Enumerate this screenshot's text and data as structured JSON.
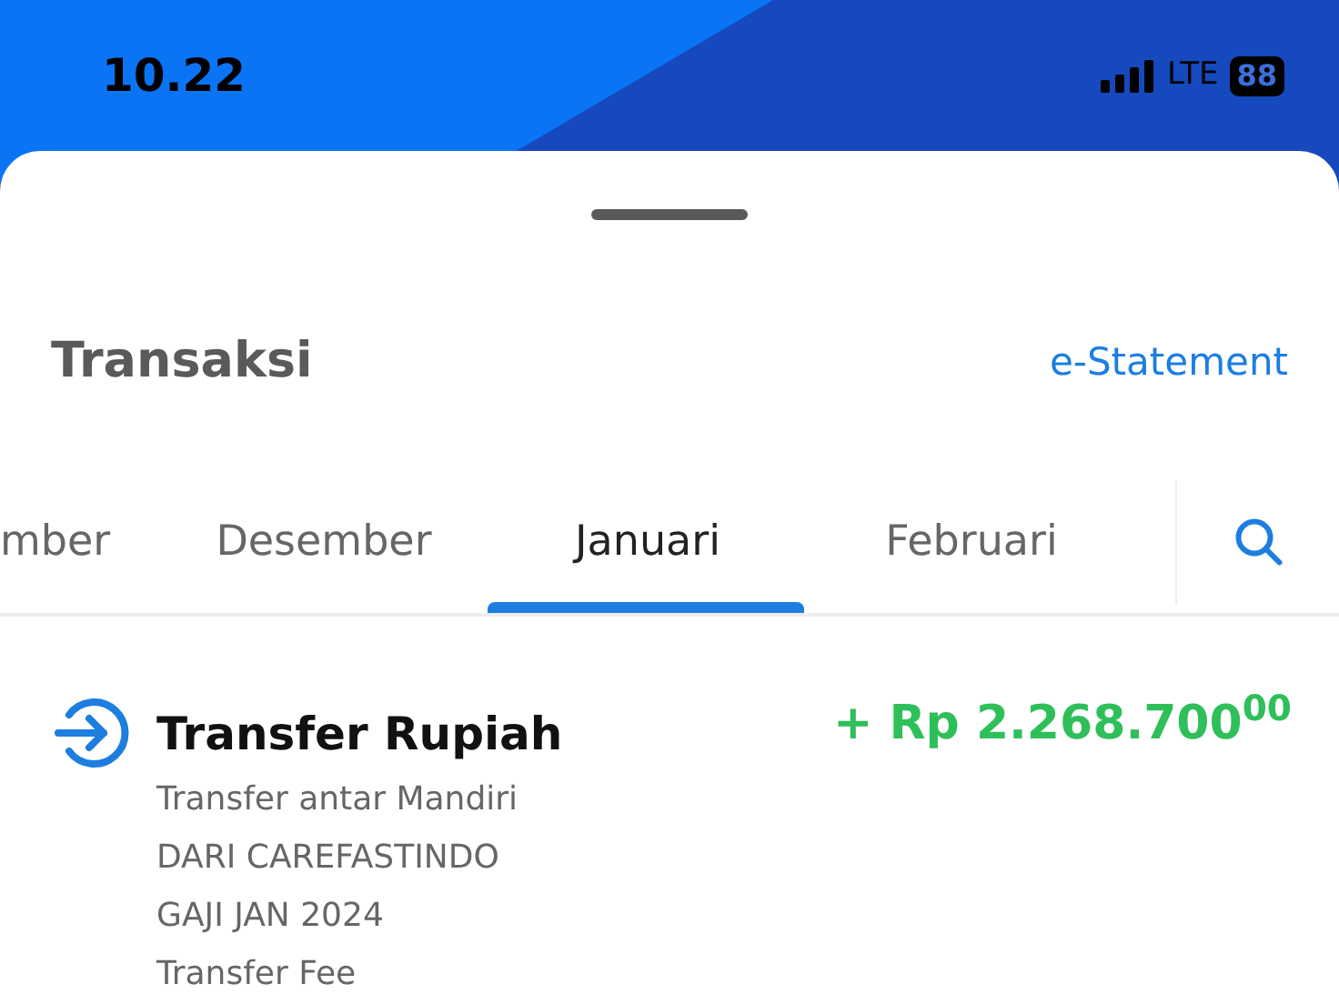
{
  "status_bar": {
    "time": "10.22",
    "network": "LTE",
    "battery": "88"
  },
  "sheet": {
    "title": "Transaksi",
    "link": "e-Statement"
  },
  "tabs": [
    {
      "label": "mber",
      "selected": false
    },
    {
      "label": "Desember",
      "selected": false
    },
    {
      "label": "Januari",
      "selected": true
    },
    {
      "label": "Februari",
      "selected": false
    }
  ],
  "transactions": [
    {
      "title": "Transfer Rupiah",
      "amount": "+ Rp 2.268.700$^{00}$",
      "details": [
        "Transfer antar Mandiri",
        "DARI CAREFASTINDO",
        "GAJI JAN 2024",
        "Transfer Fee"
      ]
    }
  ]
}
